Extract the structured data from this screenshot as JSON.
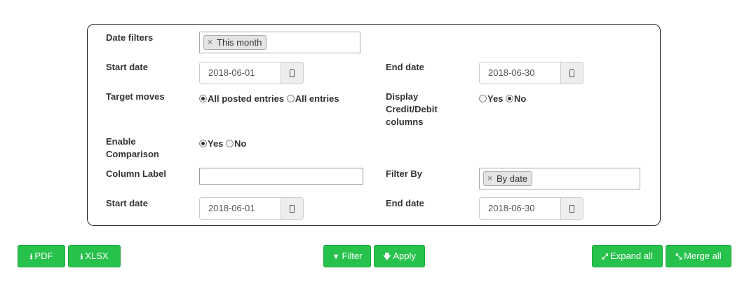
{
  "filters": {
    "date_filters_label": "Date filters",
    "date_filter_tag": "This month",
    "start_date_label": "Start date",
    "start_date_value": "2018-06-01",
    "end_date_label": "End date",
    "end_date_value": "2018-06-30",
    "target_moves_label": "Target moves",
    "target_moves_options": [
      "All posted entries",
      "All entries"
    ],
    "target_moves_selected": "All posted entries",
    "display_credit_debit_label": "Display Credit/Debit columns",
    "display_credit_debit_options": [
      "Yes",
      "No"
    ],
    "display_credit_debit_selected": "No",
    "enable_comparison_label": "Enable Comparison",
    "enable_comparison_options": [
      "Yes",
      "No"
    ],
    "enable_comparison_selected": "Yes",
    "column_label_label": "Column Label",
    "column_label_value": "",
    "filter_by_label": "Filter By",
    "filter_by_tag": "By date",
    "comparison_start_date_label": "Start date",
    "comparison_start_date_value": "2018-06-01",
    "comparison_end_date_label": "End date",
    "comparison_end_date_value": "2018-06-30"
  },
  "toolbar": {
    "pdf_label": "PDF",
    "xlsx_label": "XLSX",
    "filter_label": "Filter",
    "apply_label": "Apply",
    "expand_all_label": "Expand all",
    "merge_all_label": "Merge all"
  },
  "colors": {
    "button_green": "#27c24c",
    "panel_border": "#222222",
    "text": "#333333"
  },
  "icons": {
    "remove_tag": "×",
    "pdf": "download-icon",
    "xlsx": "download-icon",
    "filter": "filter-icon",
    "apply": "arrow-down-icon",
    "expand_all": "expand-icon",
    "merge_all": "compress-icon",
    "calendar": "calendar-icon"
  }
}
